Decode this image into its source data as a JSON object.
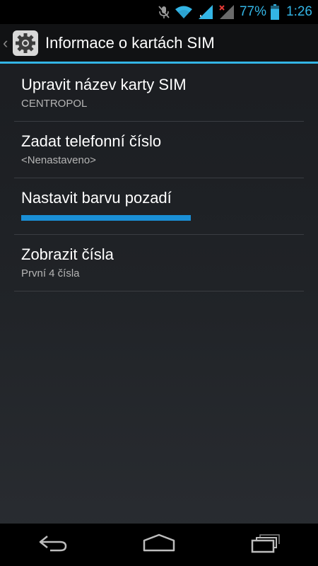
{
  "status_bar": {
    "battery_percent": "77%",
    "time": "1:26",
    "icons": [
      "muted-mic-icon",
      "wifi-icon",
      "signal-icon",
      "signal-no-data-icon",
      "battery-icon"
    ],
    "battery_level": 0.77
  },
  "action_bar": {
    "title": "Informace o kartách SIM",
    "icon": "settings-gear-icon",
    "accent_color": "#33b5e5"
  },
  "items": [
    {
      "title": "Upravit název karty SIM",
      "summary": "CENTROPOL"
    },
    {
      "title": "Zadat telefonní číslo",
      "summary": "<Nenastaveno>"
    },
    {
      "title": "Nastavit barvu pozadí",
      "selected_color": "#1a8fd6"
    },
    {
      "title": "Zobrazit čísla",
      "summary": "První 4 čísla"
    }
  ],
  "nav_bar": {
    "icons": [
      "back-icon",
      "home-icon",
      "recent-apps-icon"
    ]
  }
}
